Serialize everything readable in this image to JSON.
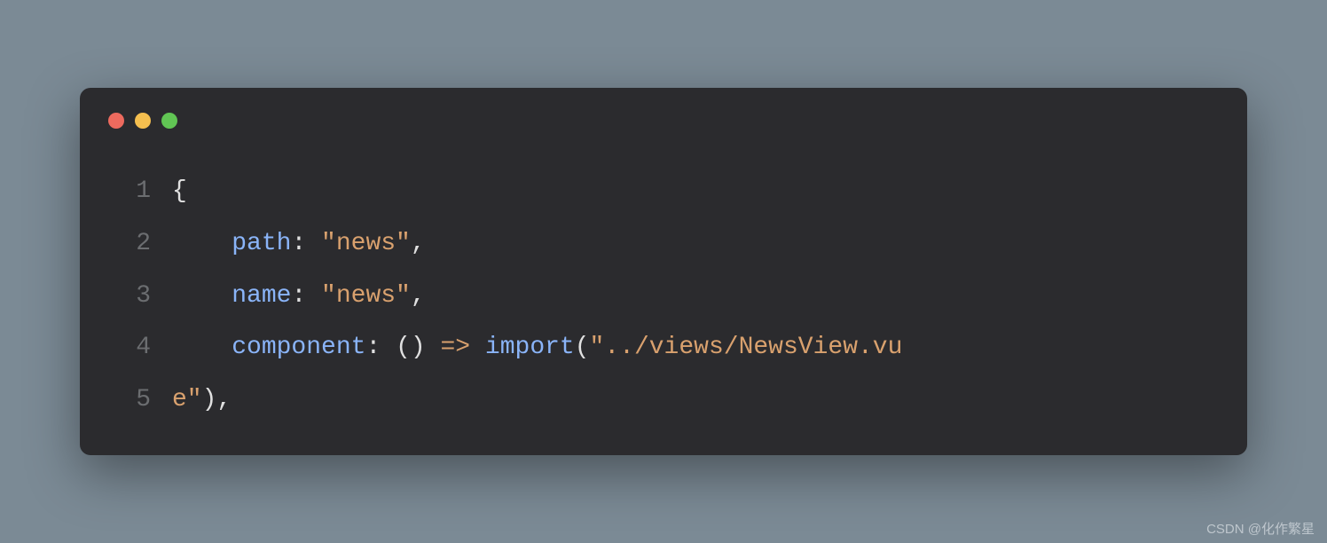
{
  "window": {
    "controls": [
      "close",
      "minimize",
      "maximize"
    ]
  },
  "code": {
    "lines": [
      {
        "num": "1",
        "tokens": [
          {
            "cls": "tok-brace",
            "text": "{"
          }
        ]
      },
      {
        "num": "2",
        "tokens": [
          {
            "cls": "",
            "text": "    "
          },
          {
            "cls": "tok-prop",
            "text": "path"
          },
          {
            "cls": "tok-punct",
            "text": ": "
          },
          {
            "cls": "tok-string",
            "text": "\"news\""
          },
          {
            "cls": "tok-punct",
            "text": ","
          }
        ]
      },
      {
        "num": "3",
        "tokens": [
          {
            "cls": "",
            "text": "    "
          },
          {
            "cls": "tok-prop",
            "text": "name"
          },
          {
            "cls": "tok-punct",
            "text": ": "
          },
          {
            "cls": "tok-string",
            "text": "\"news\""
          },
          {
            "cls": "tok-punct",
            "text": ","
          }
        ]
      },
      {
        "num": "4",
        "tokens": [
          {
            "cls": "",
            "text": "    "
          },
          {
            "cls": "tok-prop",
            "text": "component"
          },
          {
            "cls": "tok-punct",
            "text": ": "
          },
          {
            "cls": "tok-paren",
            "text": "() "
          },
          {
            "cls": "tok-arrow",
            "text": "=>"
          },
          {
            "cls": "tok-punct",
            "text": " "
          },
          {
            "cls": "tok-keyword",
            "text": "import"
          },
          {
            "cls": "tok-paren",
            "text": "("
          },
          {
            "cls": "tok-string",
            "text": "\"../views/NewsView.vu"
          }
        ]
      },
      {
        "num": "5",
        "tokens": [
          {
            "cls": "tok-string",
            "text": "e\""
          },
          {
            "cls": "tok-paren",
            "text": ")"
          },
          {
            "cls": "tok-punct",
            "text": ","
          }
        ]
      }
    ]
  },
  "watermark": "CSDN @化作繁星"
}
